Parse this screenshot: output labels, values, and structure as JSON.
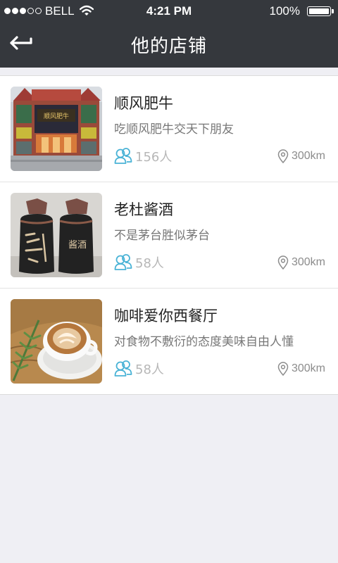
{
  "status_bar": {
    "carrier": "BELL",
    "time": "4:21 PM",
    "battery": "100%",
    "battery_level": 1.0,
    "signal_bars_filled": 3,
    "signal_bars_total": 5
  },
  "header": {
    "title": "他的店铺",
    "background": "#35383d"
  },
  "stores": [
    {
      "name": "顺风肥牛",
      "description": "吃顺风肥牛交天下朋友",
      "people": "156人",
      "distance": "300km",
      "image": "restaurant-storefront",
      "sign_text": "顺风肥牛"
    },
    {
      "name": "老杜酱酒",
      "description": "不是茅台胜似茅台",
      "people": "58人",
      "distance": "300km",
      "image": "liquor-bottles",
      "sign_text": "酱酒"
    },
    {
      "name": "咖啡爱你西餐厅",
      "description": "对食物不敷衍的态度美味自由人懂",
      "people": "58人",
      "distance": "300km",
      "image": "latte-art-coffee"
    }
  ],
  "colors": {
    "accent": "#4ab3d6",
    "page_background": "#efeff4"
  },
  "icons": {
    "back": "back-arrow-icon",
    "people": "people-icon",
    "location": "location-pin-icon",
    "wifi": "wifi-icon",
    "battery": "battery-icon"
  }
}
